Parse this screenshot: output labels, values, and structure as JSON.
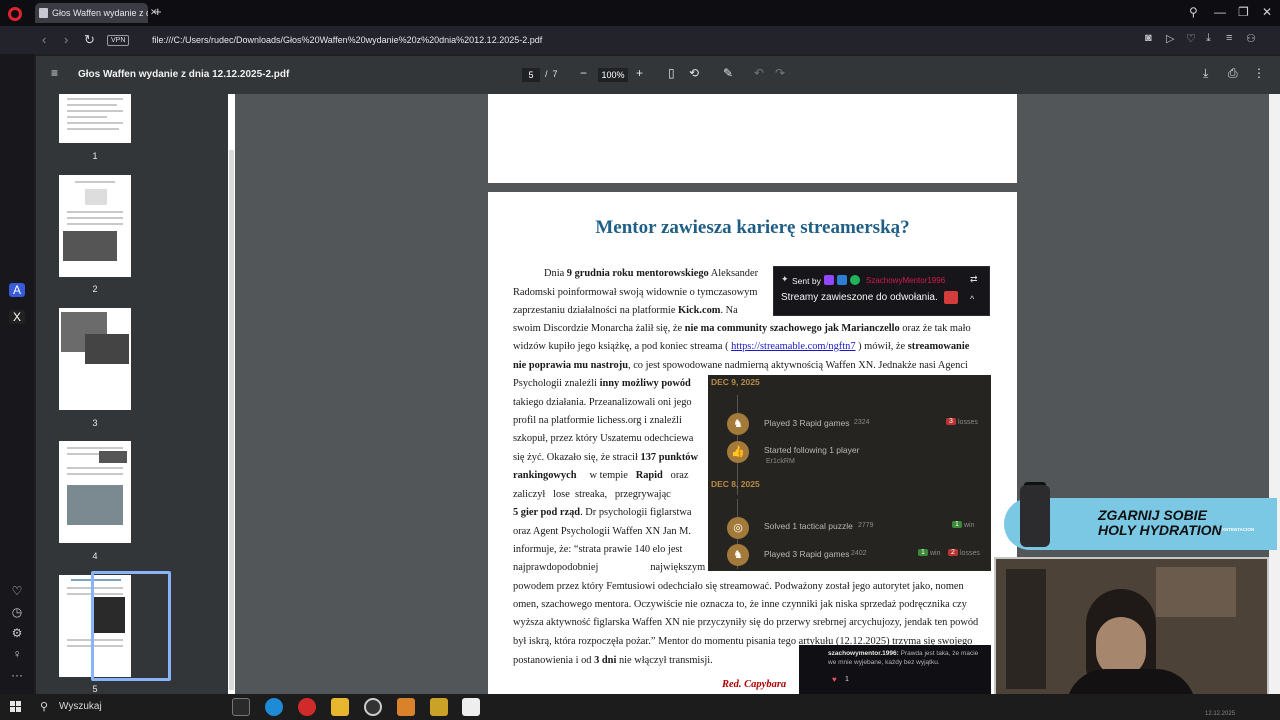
{
  "browser": {
    "tab_title": "Głos Waffen wydanie z dn",
    "url": "file:///C:/Users/rudec/Downloads/Głos%20Waffen%20wydanie%20z%20dnia%2012.12.2025-2.pdf",
    "vpn_label": "VPN"
  },
  "pdf": {
    "title": "Głos Waffen wydanie z dnia 12.12.2025-2.pdf",
    "current_page": "5",
    "page_sep": "/",
    "total_pages": "7",
    "zoom": "100%",
    "thumbnails": [
      {
        "num": "1"
      },
      {
        "num": "2"
      },
      {
        "num": "3"
      },
      {
        "num": "4"
      },
      {
        "num": "5"
      }
    ]
  },
  "article": {
    "title": "Mentor zawiesza karierę streamerską?",
    "signature": "Red. Capybara",
    "link": "https://streamable.com/ngftn7"
  },
  "activity": {
    "dates": [
      "DEC 9, 2025",
      "DEC 8, 2025"
    ],
    "rows": [
      {
        "text": "Played 3 Rapid games",
        "rating": "2324",
        "badge": "3",
        "badge_label": "losses"
      },
      {
        "text": "Started following 1 player",
        "sub": "Er1ckRM"
      },
      {
        "text": "Solved 1 tactical puzzle",
        "rating": "2779",
        "badge": "1",
        "badge_label": "win"
      },
      {
        "text": "Played 3 Rapid games",
        "rating": "2402",
        "badge": "1",
        "badge_label": "win",
        "badge2": "2",
        "badge2_label": "losses"
      }
    ]
  },
  "overlay": {
    "sent_by": "Sent by",
    "sender": "SzachowyMentor1996",
    "message": "Streamy zawieszone do odwołania.",
    "ad_text_1": "ZGARNIJ SOBIE",
    "ad_text_2": "HOLY HYDRATION",
    "ad_brand": "XNTENTACION",
    "chat_user": "szachowymentor.1996:",
    "chat_text": "Prawda jest taka, że macie we mnie wyjebane, każdy bez wyjątku.",
    "chat_reaction_count": "1"
  },
  "taskbar": {
    "search": "Wyszukaj",
    "clock": "12.12.2025"
  },
  "colors": {
    "title_blue": "#1f5f86",
    "signature_red": "#b00000",
    "lichess_gold": "#b68d47",
    "selection_blue": "#8ab4f8"
  }
}
